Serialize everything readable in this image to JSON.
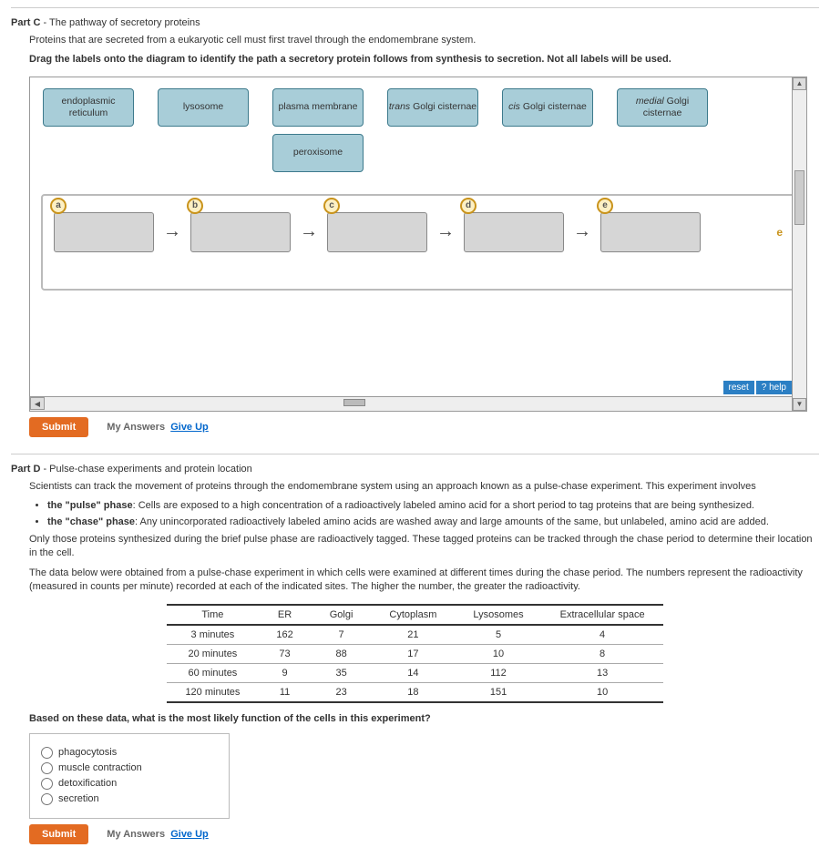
{
  "partC": {
    "title_prefix": "Part C",
    "title_suffix": " - The pathway of secretory proteins",
    "p1": "Proteins that are secreted from a eukaryotic cell must first travel through the endomembrane system.",
    "p2": "Drag the labels onto the diagram to identify the path a secretory protein follows from synthesis to secretion. Not all labels will be used.",
    "labels": [
      "endoplasmic reticulum",
      "lysosome",
      "plasma membrane",
      "trans Golgi cisternae",
      "cis Golgi cisternae",
      "medial Golgi cisternae"
    ],
    "labels_row2": [
      "peroxisome"
    ],
    "slots": [
      "a",
      "b",
      "c",
      "d",
      "e"
    ],
    "side_e": "e",
    "reset": "reset",
    "help": "? help"
  },
  "partD": {
    "title_prefix": "Part D",
    "title_suffix": " - Pulse-chase experiments and protein location",
    "p1": "Scientists can track the movement of proteins through the endomembrane system using an approach known as a pulse-chase experiment. This experiment involves",
    "bullets": [
      {
        "b": "the \"pulse\" phase",
        "t": ": Cells are exposed to a high concentration of a radioactively labeled amino acid for a short period to tag proteins that are being synthesized."
      },
      {
        "b": "the \"chase\" phase",
        "t": ": Any unincorporated radioactively labeled amino acids are washed away and large amounts of the same, but unlabeled, amino acid are added."
      }
    ],
    "p2": "Only those proteins synthesized during the brief pulse phase are radioactively tagged. These tagged proteins can be tracked through the chase period to determine their location in the cell.",
    "p3": "The data below were obtained from a pulse-chase experiment in which cells were examined at different times during the chase period. The numbers represent the radioactivity (measured in counts per minute) recorded at each of the indicated sites. The higher the number, the greater the radioactivity.",
    "question": "Based on these data, what is the most likely function of the cells in this experiment?",
    "options": [
      "phagocytosis",
      "muscle contraction",
      "detoxification",
      "secretion"
    ]
  },
  "chart_data": {
    "type": "table",
    "headers": [
      "Time",
      "ER",
      "Golgi",
      "Cytoplasm",
      "Lysosomes",
      "Extracellular space"
    ],
    "rows": [
      [
        "3 minutes",
        162,
        7,
        21,
        5,
        4
      ],
      [
        "20 minutes",
        73,
        88,
        17,
        10,
        8
      ],
      [
        "60 minutes",
        9,
        35,
        14,
        112,
        13
      ],
      [
        "120 minutes",
        11,
        23,
        18,
        151,
        10
      ]
    ]
  },
  "buttons": {
    "submit": "Submit",
    "myAnswers": "My Answers",
    "giveUp": "Give Up"
  }
}
